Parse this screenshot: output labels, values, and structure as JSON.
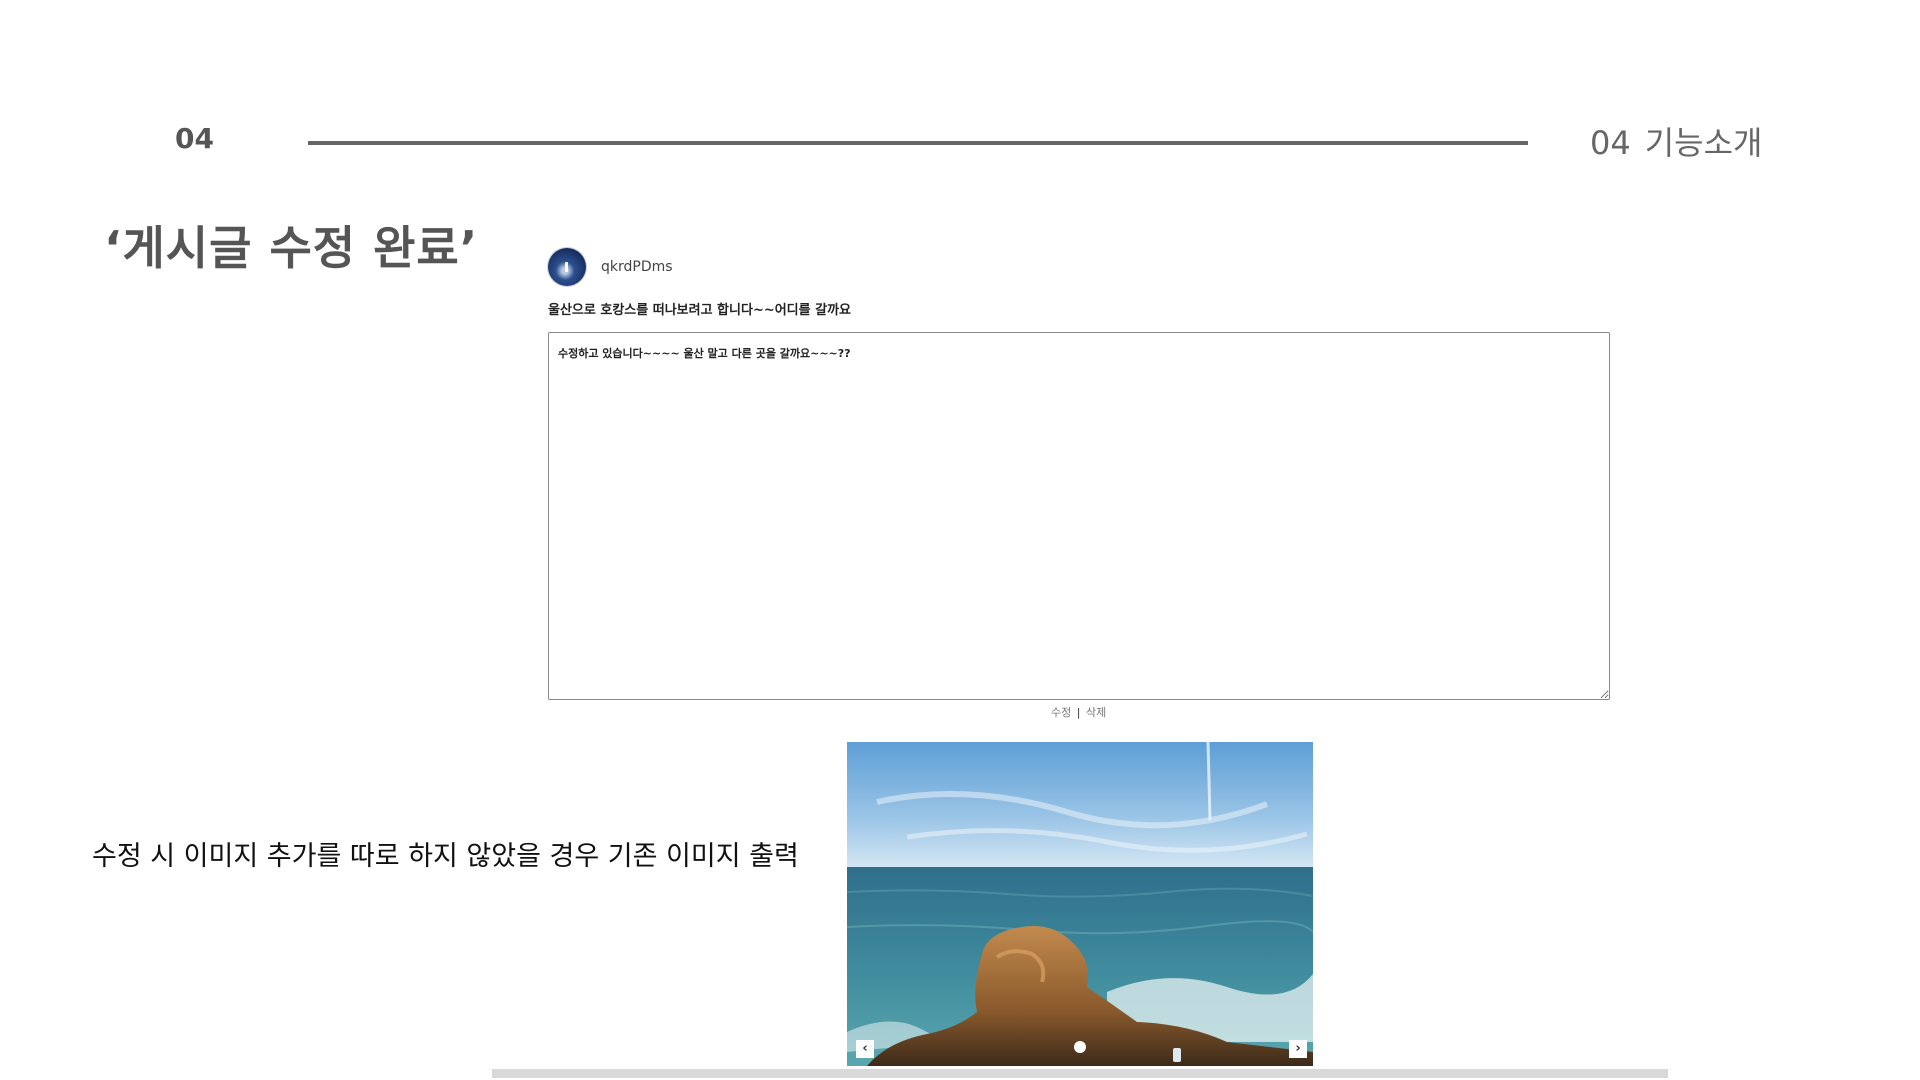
{
  "slide": {
    "page_number": "04",
    "section_number": "04",
    "section_title": "기능소개",
    "heading": "‘게시글 수정 완료’",
    "caption": "수정 시 이미지 추가를 따로 하지 않았을 경우 기존 이미지 출력"
  },
  "post": {
    "username": "qkrdPDms",
    "title": "울산으로 호캉스를 떠나보려고 합니다~~어디를 갈까요",
    "content": "수정하고 있습니다~~~~ 울산 말고 다른 곳을 갈까요~~~??",
    "edit_label": "수정",
    "separator": "|",
    "delete_label": "삭제"
  },
  "carousel": {
    "prev_label": "‹",
    "next_label": "›",
    "active_slide": 1,
    "slide_count": 1
  },
  "icons": {
    "avatar": "profile-avatar",
    "prev": "chevron-left-icon",
    "next": "chevron-right-icon"
  },
  "colors": {
    "header_rule": "#666666",
    "heading": "#555555",
    "textarea_border": "#8a8a8a"
  }
}
